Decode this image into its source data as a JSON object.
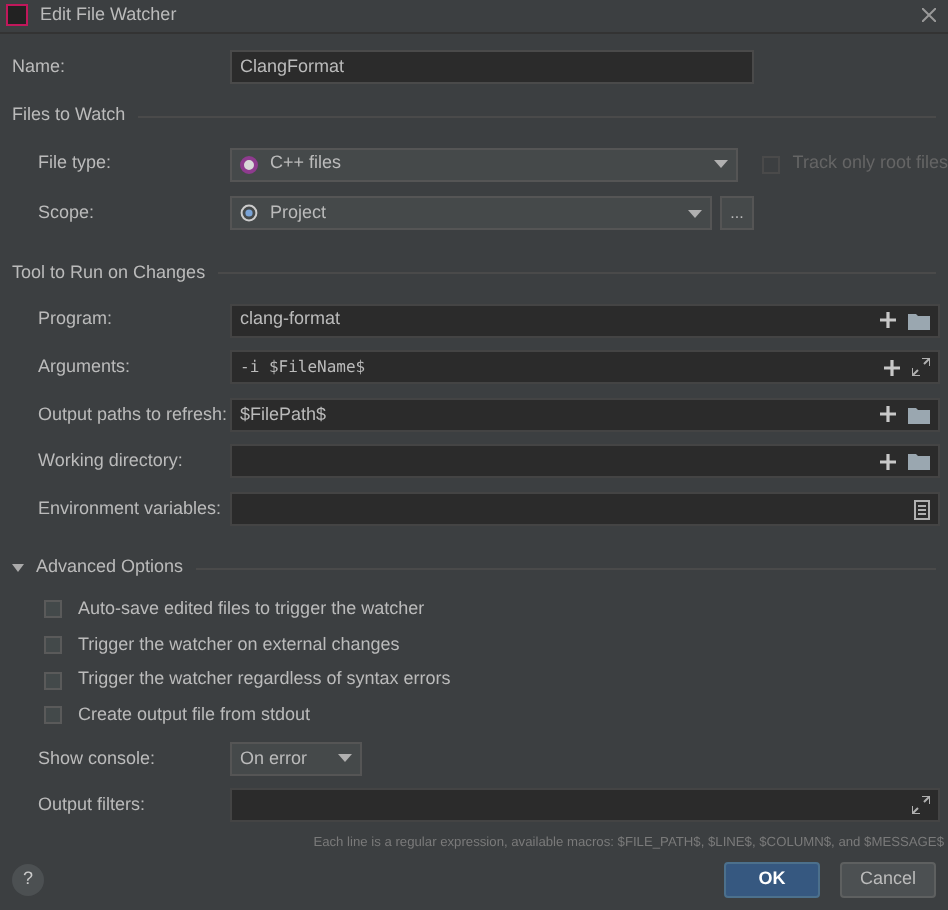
{
  "window": {
    "title": "Edit File Watcher"
  },
  "name_field": {
    "label": "Name:",
    "value": "ClangFormat"
  },
  "files_to_watch": {
    "title": "Files to Watch",
    "file_type": {
      "label": "File type:",
      "value": "C++ files"
    },
    "track_root": {
      "label": "Track only root files",
      "checked": false,
      "disabled": true
    },
    "scope": {
      "label": "Scope:",
      "value": "Project",
      "more": "..."
    }
  },
  "tool": {
    "title": "Tool to Run on Changes",
    "fields": [
      {
        "label": "Program:",
        "value": "clang-format",
        "kind": "path"
      },
      {
        "label": "Arguments:",
        "value": "-i $FileName$",
        "kind": "macro"
      },
      {
        "label": "Output paths to refresh:",
        "value": "$FilePath$",
        "kind": "path"
      },
      {
        "label": "Working directory:",
        "kind": "path"
      },
      {
        "label": "Environment variables:",
        "kind": "env"
      }
    ]
  },
  "advanced": {
    "title": "Advanced Options",
    "expanded": true,
    "options": [
      {
        "label": "Auto-save edited files to trigger the watcher",
        "checked": false
      },
      {
        "label": "Trigger the watcher on external changes",
        "checked": false
      },
      {
        "label": "Trigger the watcher regardless of syntax errors",
        "checked": false
      },
      {
        "label": "Create output file from stdout",
        "checked": false
      }
    ],
    "show_console": {
      "label": "Show console:",
      "value": "On error"
    },
    "output_filters": {
      "label": "Output filters:",
      "hint": "Each line is a regular expression, available macros: $FILE_PATH$, $LINE$, $COLUMN$, and $MESSAGE$"
    }
  },
  "help": "?",
  "buttons": [
    {
      "label": "OK",
      "primary": true
    },
    {
      "label": "Cancel",
      "primary": false
    }
  ]
}
